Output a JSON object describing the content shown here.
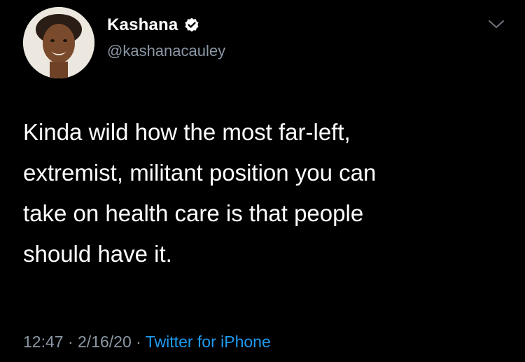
{
  "author": {
    "display_name": "Kashana",
    "handle": "@kashanacauley",
    "verified": true
  },
  "tweet": {
    "text_lines": [
      "Kinda wild how the most far-left,",
      "extremist, militant position you can",
      "take on health care is that people",
      "should have it."
    ]
  },
  "meta": {
    "time": "12:47",
    "separator": "·",
    "date": "2/16/20",
    "source": "Twitter for iPhone"
  },
  "colors": {
    "background": "#000000",
    "text": "#ffffff",
    "secondary": "#8b98a5",
    "link": "#1d9bf0"
  },
  "icons": {
    "verified": "verified-badge-icon",
    "menu": "chevron-down-icon"
  }
}
